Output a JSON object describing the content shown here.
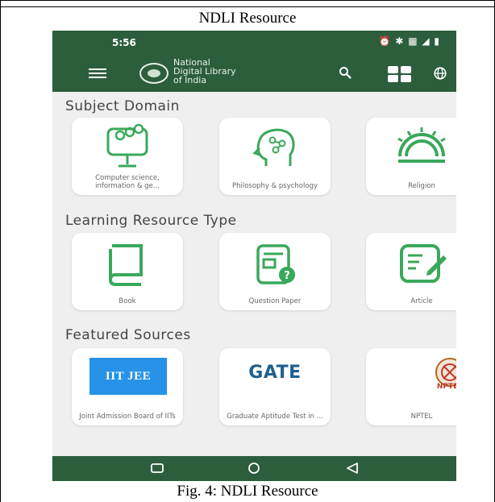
{
  "document": {
    "title": "NDLI Resource",
    "caption": "Fig. 4: NDLI Resource"
  },
  "status_bar": {
    "time": "5:56",
    "icons_text": "⏰ ✱ ▦ ◢ ▮"
  },
  "app_bar": {
    "logo_lines": [
      "National",
      "Digital Library",
      "of India"
    ]
  },
  "sections": [
    {
      "title": "Subject Domain",
      "cards": [
        {
          "label": "Computer science, information & ge...",
          "icon": "computer-science-icon"
        },
        {
          "label": "Philosophy & psychology",
          "icon": "philosophy-head-icon"
        },
        {
          "label": "Religion",
          "icon": "religion-sun-icon"
        }
      ]
    },
    {
      "title": "Learning Resource Type",
      "cards": [
        {
          "label": "Book",
          "icon": "book-icon"
        },
        {
          "label": "Question Paper",
          "icon": "question-paper-icon"
        },
        {
          "label": "Article",
          "icon": "article-icon"
        }
      ]
    },
    {
      "title": "Featured Sources",
      "cards": [
        {
          "label": "Joint Admission Board of IITs",
          "badge": "IIT JEE"
        },
        {
          "label": "Graduate Aptitude Test in ...",
          "badge": "GATE"
        },
        {
          "label": "NPTEL",
          "badge": "NPTEL"
        }
      ]
    }
  ],
  "colors": {
    "app_green": "#2c5e3c",
    "icon_green": "#3aa85a",
    "background": "#efefef",
    "iit_blue": "#2793e8",
    "gate_blue": "#1f5f8f",
    "nptel_red": "#c0392b"
  },
  "nav_bar": {
    "icons": [
      "recent-apps-icon",
      "home-icon",
      "back-icon"
    ]
  }
}
